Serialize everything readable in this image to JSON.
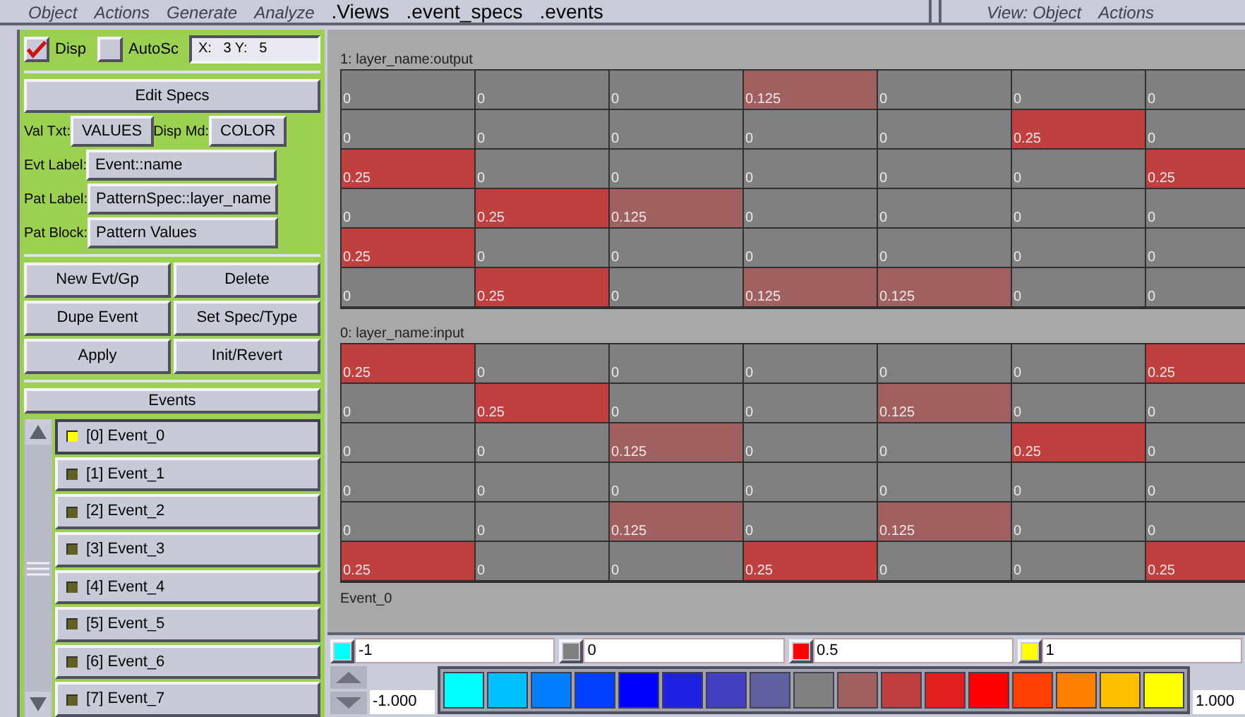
{
  "menubar": {
    "items": [
      {
        "label": "Object",
        "kind": "menu"
      },
      {
        "label": "Actions",
        "kind": "menu"
      },
      {
        "label": "Generate",
        "kind": "menu"
      },
      {
        "label": "Analyze",
        "kind": "menu"
      },
      {
        "label": ".Views",
        "kind": "tab"
      },
      {
        "label": ".event_specs",
        "kind": "tab"
      },
      {
        "label": ".events",
        "kind": "tab"
      }
    ],
    "view_menu": [
      {
        "label": "View: Object"
      },
      {
        "label": "Actions"
      }
    ]
  },
  "left_panel": {
    "disp": {
      "label": "Disp",
      "checked": true
    },
    "autosc": {
      "label": "AutoSc",
      "checked": false
    },
    "xy_field": "X:   3 Y:   5",
    "edit_specs": "Edit Specs",
    "settings": [
      [
        {
          "label": "Val Txt:",
          "value": "VALUES"
        },
        {
          "label": "Disp Md:",
          "value": "COLOR"
        }
      ],
      [
        {
          "label": "Evt Label:",
          "value": "Event::name"
        }
      ],
      [
        {
          "label": "Pat Label:",
          "value": "PatternSpec::layer_name"
        }
      ],
      [
        {
          "label": "Pat Block:",
          "value": "Pattern Values"
        }
      ]
    ],
    "buttons": [
      "New Evt/Gp",
      "Delete",
      "Dupe Event",
      "Set Spec/Type",
      "Apply",
      "Init/Revert"
    ],
    "events_header": "Events",
    "events": [
      {
        "label": "[0] Event_0",
        "selected": true
      },
      {
        "label": "[1] Event_1",
        "selected": false
      },
      {
        "label": "[2] Event_2",
        "selected": false
      },
      {
        "label": "[3] Event_3",
        "selected": false
      },
      {
        "label": "[4] Event_4",
        "selected": false
      },
      {
        "label": "[5] Event_5",
        "selected": false
      },
      {
        "label": "[6] Event_6",
        "selected": false
      },
      {
        "label": "[7] Event_7",
        "selected": false
      }
    ]
  },
  "grid_view": {
    "layers": [
      {
        "title": "1: layer_name:output",
        "rows": [
          [
            "0",
            "0",
            "0",
            "0.125",
            "0",
            "0",
            "0"
          ],
          [
            "0",
            "0",
            "0",
            "0",
            "0",
            "0.25",
            "0"
          ],
          [
            "0.25",
            "0",
            "0",
            "0",
            "0",
            "0",
            "0.25"
          ],
          [
            "0",
            "0.25",
            "0.125",
            "0",
            "0",
            "0",
            "0"
          ],
          [
            "0.25",
            "0",
            "0",
            "0",
            "0",
            "0",
            "0"
          ],
          [
            "0",
            "0.25",
            "0",
            "0.125",
            "0.125",
            "0",
            "0"
          ]
        ]
      },
      {
        "title": "0: layer_name:input",
        "rows": [
          [
            "0.25",
            "0",
            "0",
            "0",
            "0",
            "0",
            "0.25"
          ],
          [
            "0",
            "0.25",
            "0",
            "0",
            "0.125",
            "0",
            "0"
          ],
          [
            "0",
            "0",
            "0.125",
            "0",
            "0",
            "0.25",
            "0"
          ],
          [
            "0",
            "0",
            "0",
            "0",
            "0",
            "0",
            "0"
          ],
          [
            "0",
            "0",
            "0.125",
            "0",
            "0.125",
            "0",
            "0"
          ],
          [
            "0.25",
            "0",
            "0",
            "0.25",
            "0",
            "0",
            "0.25"
          ]
        ]
      }
    ],
    "event_name": "Event_0"
  },
  "color_bar": {
    "fields": [
      {
        "value": "-1",
        "color": "#00ffff"
      },
      {
        "value": "0",
        "color": "#808080"
      },
      {
        "value": "0.5",
        "color": "#ff0000"
      },
      {
        "value": "1",
        "color": "#ffff00"
      }
    ],
    "min": "-1.000",
    "max": "1.000",
    "swatches": [
      {
        "color": "#00ffff"
      },
      {
        "color": "#00bfff"
      },
      {
        "color": "#0080ff"
      },
      {
        "color": "#0040ff"
      },
      {
        "color": "#0000ff"
      },
      {
        "color": "#2020e0"
      },
      {
        "color": "#4040c0"
      },
      {
        "color": "#6060a0"
      },
      {
        "color": "#808080"
      },
      {
        "color": "#a06060"
      },
      {
        "color": "#c04040"
      },
      {
        "color": "#e02020"
      },
      {
        "color": "#ff0000"
      },
      {
        "color": "#ff4000"
      },
      {
        "color": "#ff8000"
      },
      {
        "color": "#ffbf00"
      },
      {
        "color": "#ffff00"
      }
    ]
  }
}
